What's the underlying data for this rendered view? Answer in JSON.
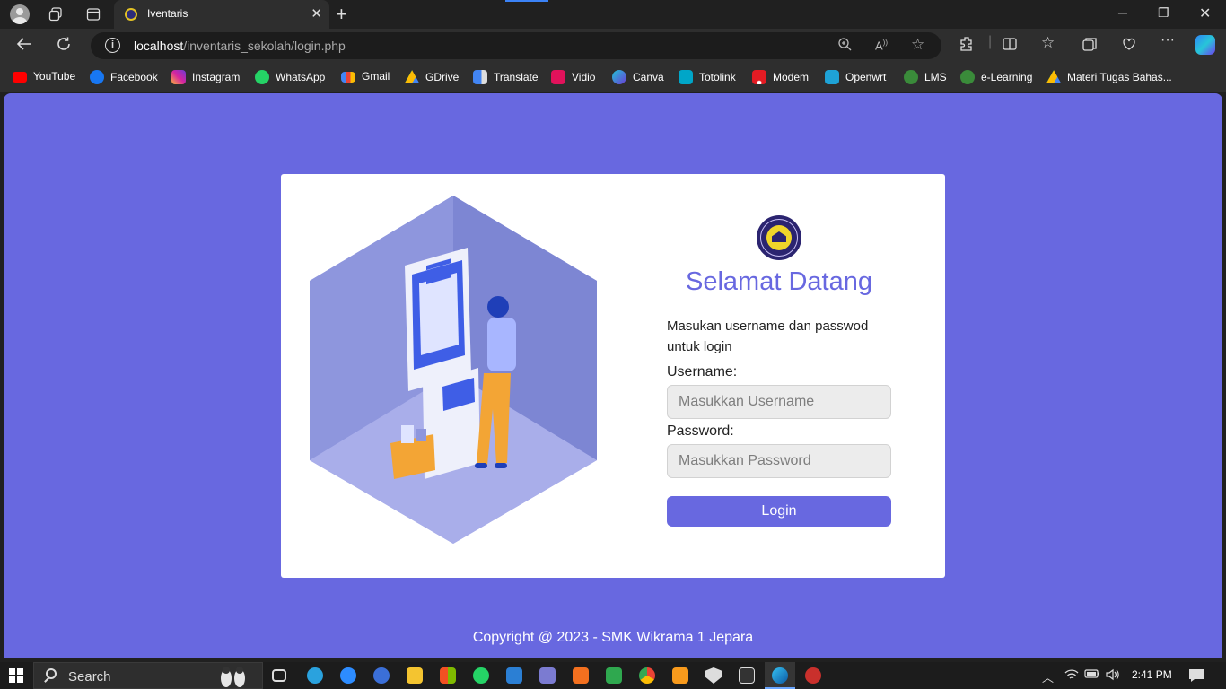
{
  "browser": {
    "tab_title": "Iventaris",
    "url_host": "localhost",
    "url_path": "/inventaris_sekolah/login.php",
    "tab_close": "✕",
    "new_tab": "+"
  },
  "bookmarks": [
    {
      "label": "YouTube",
      "icon": "youtube-icon",
      "color": "#ff0000"
    },
    {
      "label": "Facebook",
      "icon": "facebook-icon",
      "color": "#1877f2"
    },
    {
      "label": "Instagram",
      "icon": "instagram-icon",
      "color": "#d6249f"
    },
    {
      "label": "WhatsApp",
      "icon": "whatsapp-icon",
      "color": "#25d366"
    },
    {
      "label": "Gmail",
      "icon": "gmail-icon",
      "color": "#ea4335"
    },
    {
      "label": "GDrive",
      "icon": "gdrive-icon",
      "color": "#34a853"
    },
    {
      "label": "Translate",
      "icon": "translate-icon",
      "color": "#4285f4"
    },
    {
      "label": "Vidio",
      "icon": "vidio-icon",
      "color": "#e1125b"
    },
    {
      "label": "Canva",
      "icon": "canva-icon",
      "color": "#2f6ae3"
    },
    {
      "label": "Totolink",
      "icon": "totolink-icon",
      "color": "#00a6c8"
    },
    {
      "label": "Modem",
      "icon": "huawei-icon",
      "color": "#e31b23"
    },
    {
      "label": "Openwrt",
      "icon": "openwrt-icon",
      "color": "#1ea2d6"
    },
    {
      "label": "LMS",
      "icon": "lms-icon",
      "color": "#3a8b3a"
    },
    {
      "label": "e-Learning",
      "icon": "elearning-icon",
      "color": "#3a8b3a"
    },
    {
      "label": "Materi Tugas Bahas...",
      "icon": "gdrive-icon",
      "color": "#fbbc04"
    }
  ],
  "page": {
    "welcome": "Selamat Datang",
    "subtitle": "Masukan username dan passwod untuk login",
    "username_label": "Username:",
    "username_placeholder": "Masukkan Username",
    "password_label": "Password:",
    "password_placeholder": "Masukkan Password",
    "login_button": "Login",
    "copyright": "Copyright @ 2023 - SMK Wikrama 1 Jepara"
  },
  "taskbar": {
    "search_label": "Search",
    "time": "2:41 PM"
  },
  "colors": {
    "accent": "#6868e0",
    "card": "#ffffff"
  }
}
